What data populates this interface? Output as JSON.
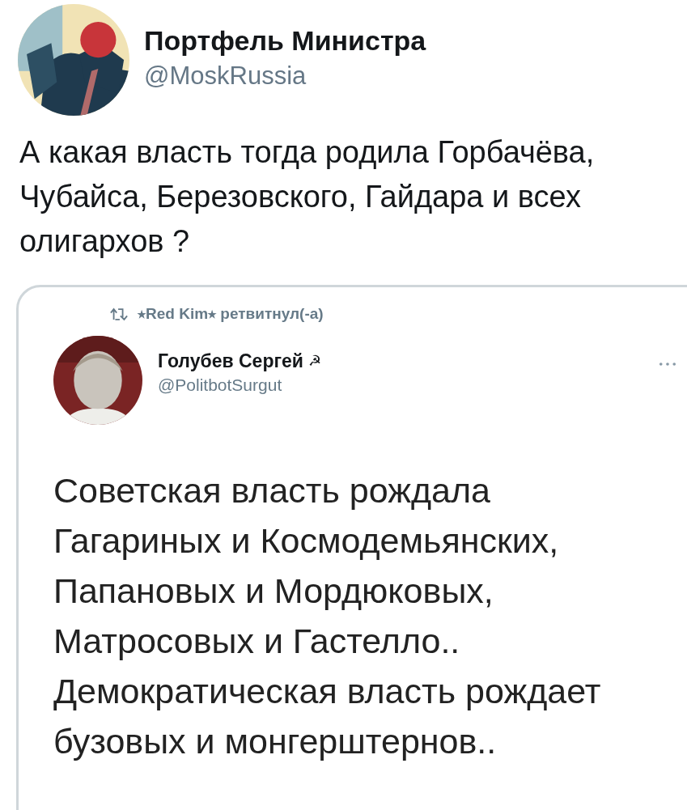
{
  "tweet": {
    "author": {
      "name": "Портфель Министра",
      "handle": "@MoskRussia"
    },
    "text": "А какая власть тогда родила Горбачёва,\nЧубайса, Березовского, Гайдара и всех\nолигархов ?",
    "quoted_screenshot": {
      "retweet_line": "⭑Red Kim⭑ ретвитнул(-а)",
      "author": {
        "name": "Голубев Сергей",
        "badge": "☭",
        "handle": "@PolitbotSurgut"
      },
      "text": "Советская власть рождала\nГагариных и Космодемьянских,\nПапановых и Мордюковых,\nМатросовых и Гастелло..\nДемократическая власть рождает\nбузовых и монгерштернов.."
    }
  }
}
